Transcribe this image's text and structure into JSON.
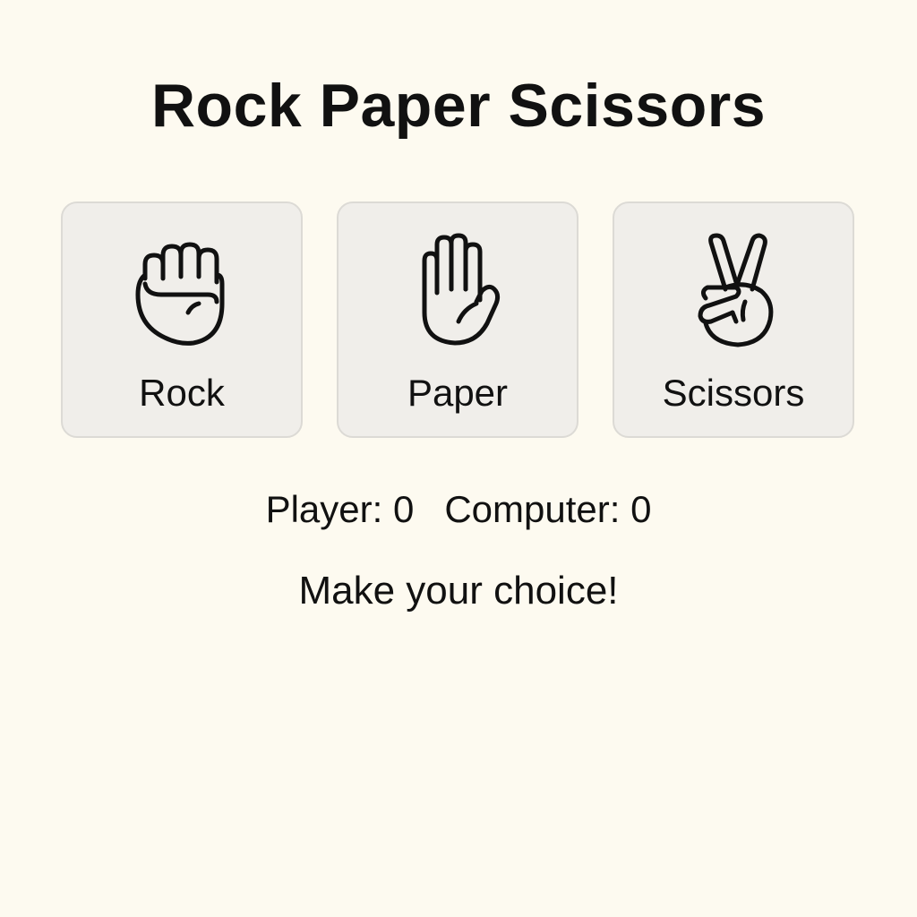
{
  "header": {
    "title": "Rock Paper Scissors"
  },
  "choices": [
    {
      "label": "Rock",
      "icon": "fist-icon"
    },
    {
      "label": "Paper",
      "icon": "open-hand-icon"
    },
    {
      "label": "Scissors",
      "icon": "victory-hand-icon"
    }
  ],
  "score": {
    "player_label": "Player:",
    "player_value": "0",
    "computer_label": "Computer:",
    "computer_value": "0"
  },
  "status": {
    "message": "Make your choice!"
  },
  "colors": {
    "background": "#fdfaf0",
    "card": "#f0eeea",
    "card_border": "#dcdad5",
    "text": "#111111"
  }
}
